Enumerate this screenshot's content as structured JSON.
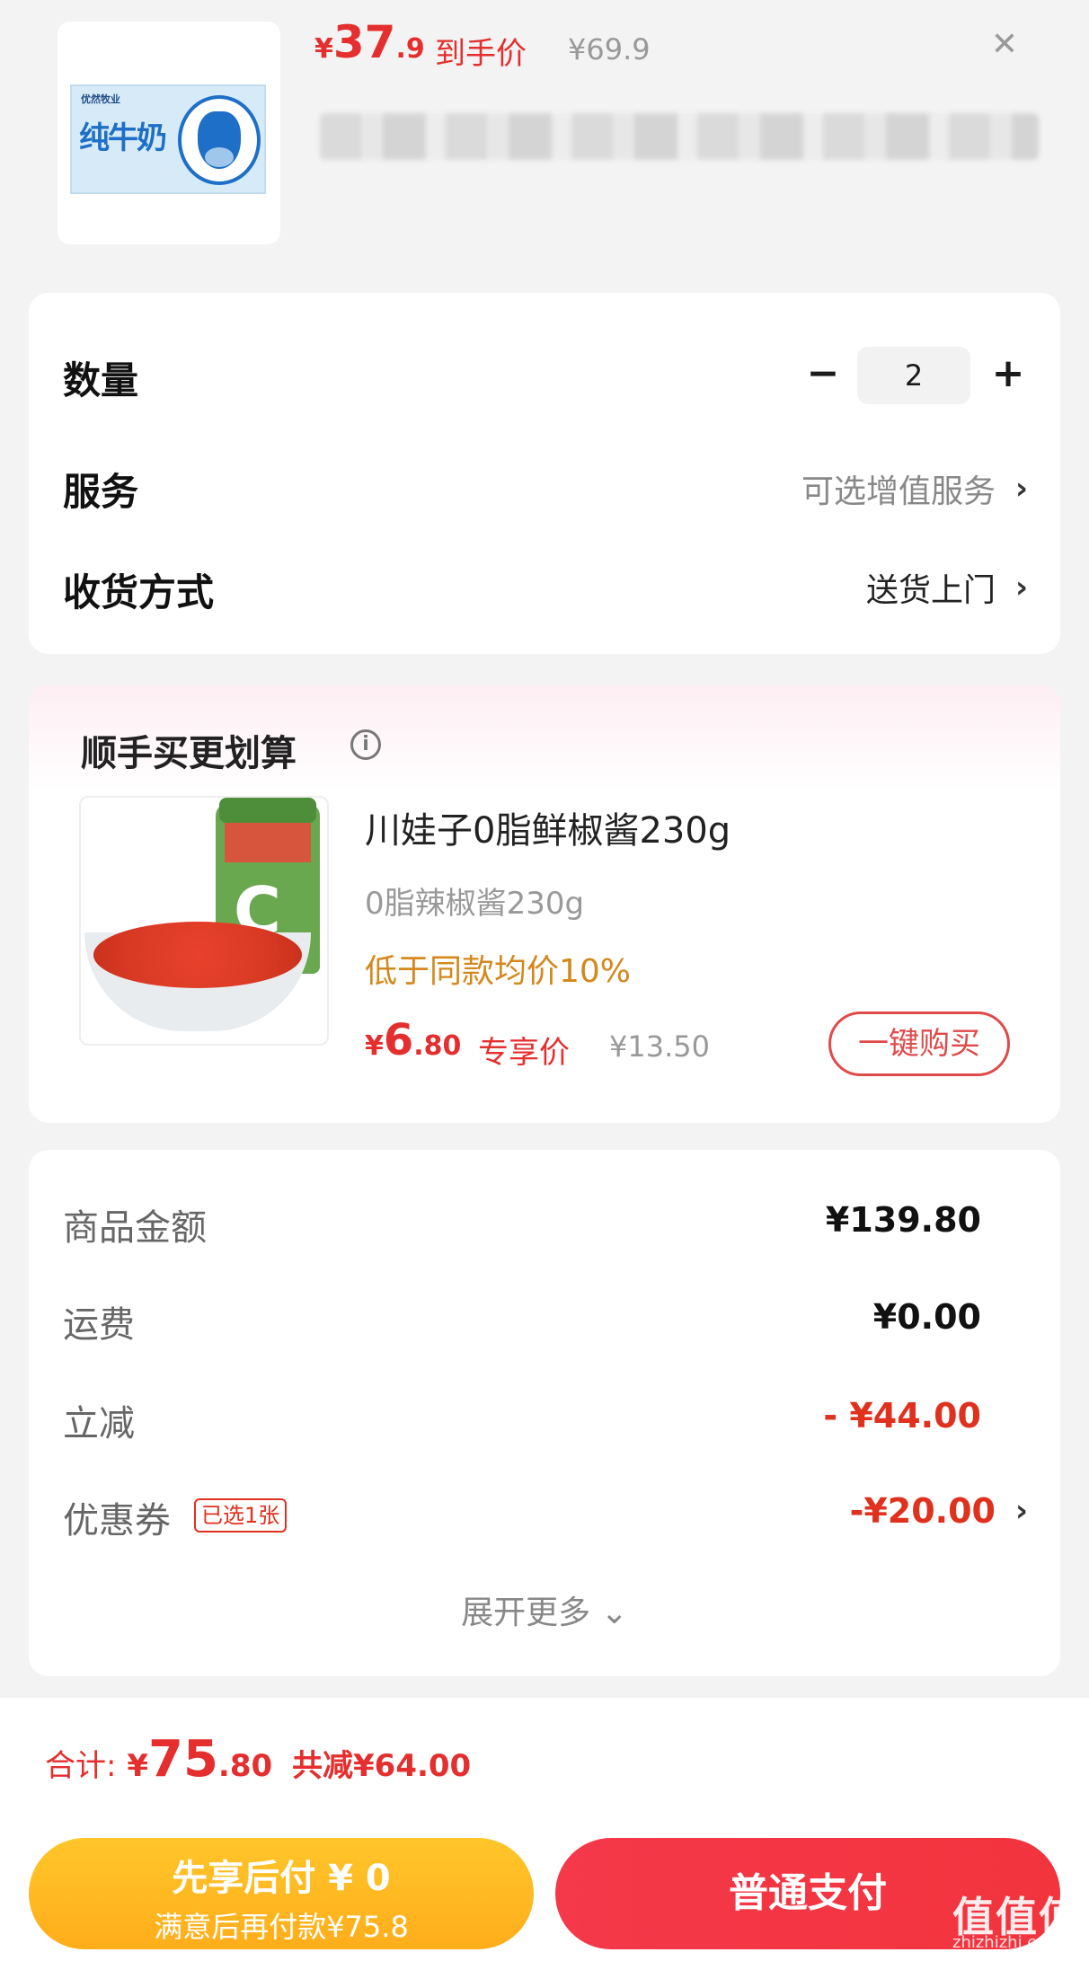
{
  "header": {
    "product_image_alt": "纯牛奶",
    "product_brand": "优然牧业",
    "product_name_on_box": "纯牛奶",
    "price_symbol": "¥",
    "price_int": "37",
    "price_dec": ".9",
    "price_label": "到手价",
    "original_price": "¥69.9",
    "close_icon": "close-icon"
  },
  "options": {
    "quantity_label": "数量",
    "quantity_value": "2",
    "minus_label": "−",
    "plus_label": "+",
    "service_label": "服务",
    "service_value": "可选增值服务",
    "delivery_label": "收货方式",
    "delivery_value": "送货上门",
    "chevron": "›"
  },
  "upsell": {
    "title": "顺手买更划算",
    "info_glyph": "i",
    "product_name": "川娃子0脂鲜椒酱230g",
    "spec": "0脂辣椒酱230g",
    "badge": "低于同款均价10%",
    "price_symbol": "¥",
    "price_int": "6",
    "price_dec": ".80",
    "price_label": "专享价",
    "original_price": "¥13.50",
    "buy_button": "一键购买"
  },
  "summary": {
    "items": [
      {
        "label": "商品金额",
        "value": "¥139.80"
      },
      {
        "label": "运费",
        "value": "¥0.00"
      },
      {
        "label": "立减",
        "value": "- ¥44.00"
      },
      {
        "label": "优惠券",
        "value": "-¥20.00",
        "tag": "已选1张"
      }
    ],
    "expand_label": "展开更多",
    "expand_chevron": "⌄"
  },
  "bottom": {
    "total_label": "合计:",
    "total_symbol": "¥",
    "total_int": "75",
    "total_dec": ".80",
    "total_saved": "共减¥64.00",
    "pay_later_line1": "先享后付 ¥ 0",
    "pay_later_line2": "满意后再付款¥75.8",
    "pay_normal": "普通支付",
    "watermark": "值值值",
    "watermark_sub": "zhizhizhi.com"
  },
  "colors": {
    "accent_red": "#e52e2e",
    "pay_later_yellow": "#ffb81f",
    "pay_normal_red": "#f5384a",
    "badge_orange": "#d4881c"
  }
}
